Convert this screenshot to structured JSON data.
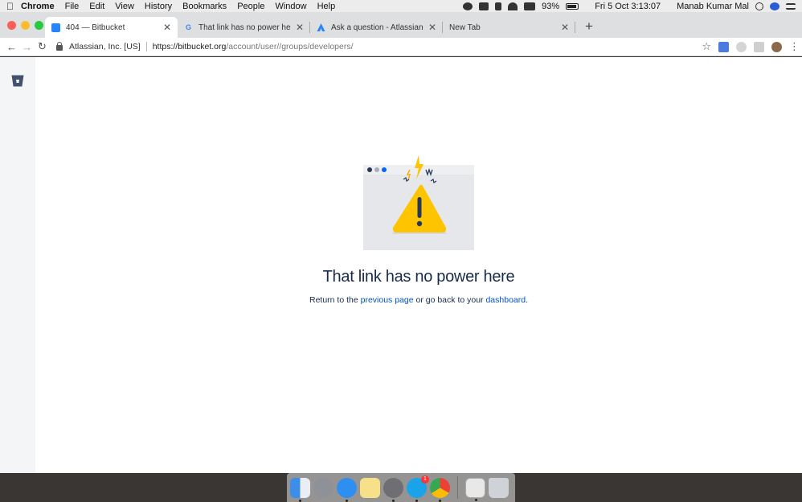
{
  "menubar": {
    "app_name": "Chrome",
    "menus": [
      "File",
      "Edit",
      "View",
      "History",
      "Bookmarks",
      "People",
      "Window",
      "Help"
    ],
    "battery": "93%",
    "datetime": "Fri 5 Oct  3:13:07",
    "user": "Manab Kumar Mal"
  },
  "tabs": [
    {
      "title": "404 — Bitbucket",
      "favicon": "bitbucket-icon"
    },
    {
      "title": "That link has no power here bi",
      "favicon": "google-icon"
    },
    {
      "title": "Ask a question - Atlassian Con",
      "favicon": "atlassian-icon"
    },
    {
      "title": "New Tab",
      "favicon": ""
    }
  ],
  "new_tab_symbol": "+",
  "toolbar": {
    "org": "Atlassian, Inc. [US]",
    "url_main": "https://bitbucket.org",
    "url_path": "/account/user//groups/developers/"
  },
  "error": {
    "title": "That link has no power here",
    "msg_prefix": "Return to the ",
    "link1": "previous page",
    "msg_middle": " or go back to your ",
    "link2": "dashboard",
    "msg_suffix": "."
  },
  "dock": {
    "skype_badge": "1",
    "items": [
      "finder-icon",
      "launchpad-icon",
      "safari-icon",
      "notes-icon",
      "system-preferences-icon",
      "skype-icon",
      "chrome-icon",
      "preview-icon",
      "trash-icon"
    ]
  },
  "colors": {
    "link": "#0052cc",
    "heading": "#172b4d",
    "warning": "#ffc400",
    "sidebar": "#f4f5f7"
  }
}
